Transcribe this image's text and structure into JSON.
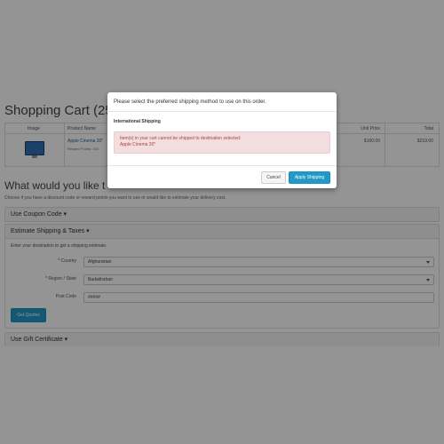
{
  "cart": {
    "title": "Shopping Cart  (25",
    "columns": {
      "image": "Image",
      "product_name": "Product Name",
      "unit_price": "Unit Price",
      "total": "Total"
    },
    "row": {
      "product_name": "Apple Cinema 30\"",
      "reward_points": "Reward Points: 100",
      "unit_price": "$100.00",
      "total": "$219.00"
    }
  },
  "next_steps": {
    "title": "What would you like t",
    "subtitle": "Choose if you have a discount code or reward points you want to use or would like to estimate your delivery cost."
  },
  "panels": {
    "coupon": "Use Coupon Code ▾",
    "shipping": "Estimate Shipping & Taxes ▾",
    "gift": "Use Gift Certificate ▾"
  },
  "shipping_form": {
    "hint": "Enter your destination to get a shipping estimate.",
    "country_label": "Country",
    "country_value": "Afghanistan",
    "region_label": "Region / State",
    "region_value": "Badakhshan",
    "postcode_label": "Post Code",
    "postcode_value": "#####",
    "get_quotes": "Get Quotes"
  },
  "modal": {
    "header": "Please select the preferred shipping method to use on this order.",
    "section": "International Shipping",
    "alert_line1": "Item(s) in your cart cannot be shipped to destination selected:",
    "alert_line2": "Apple Cinema 30\"",
    "cancel": "Cancel",
    "apply": "Apply Shipping"
  },
  "colors": {
    "primary": "#229ac8",
    "alert_bg": "#f2dede",
    "alert_text": "#a94442",
    "overlay": "#555555"
  }
}
